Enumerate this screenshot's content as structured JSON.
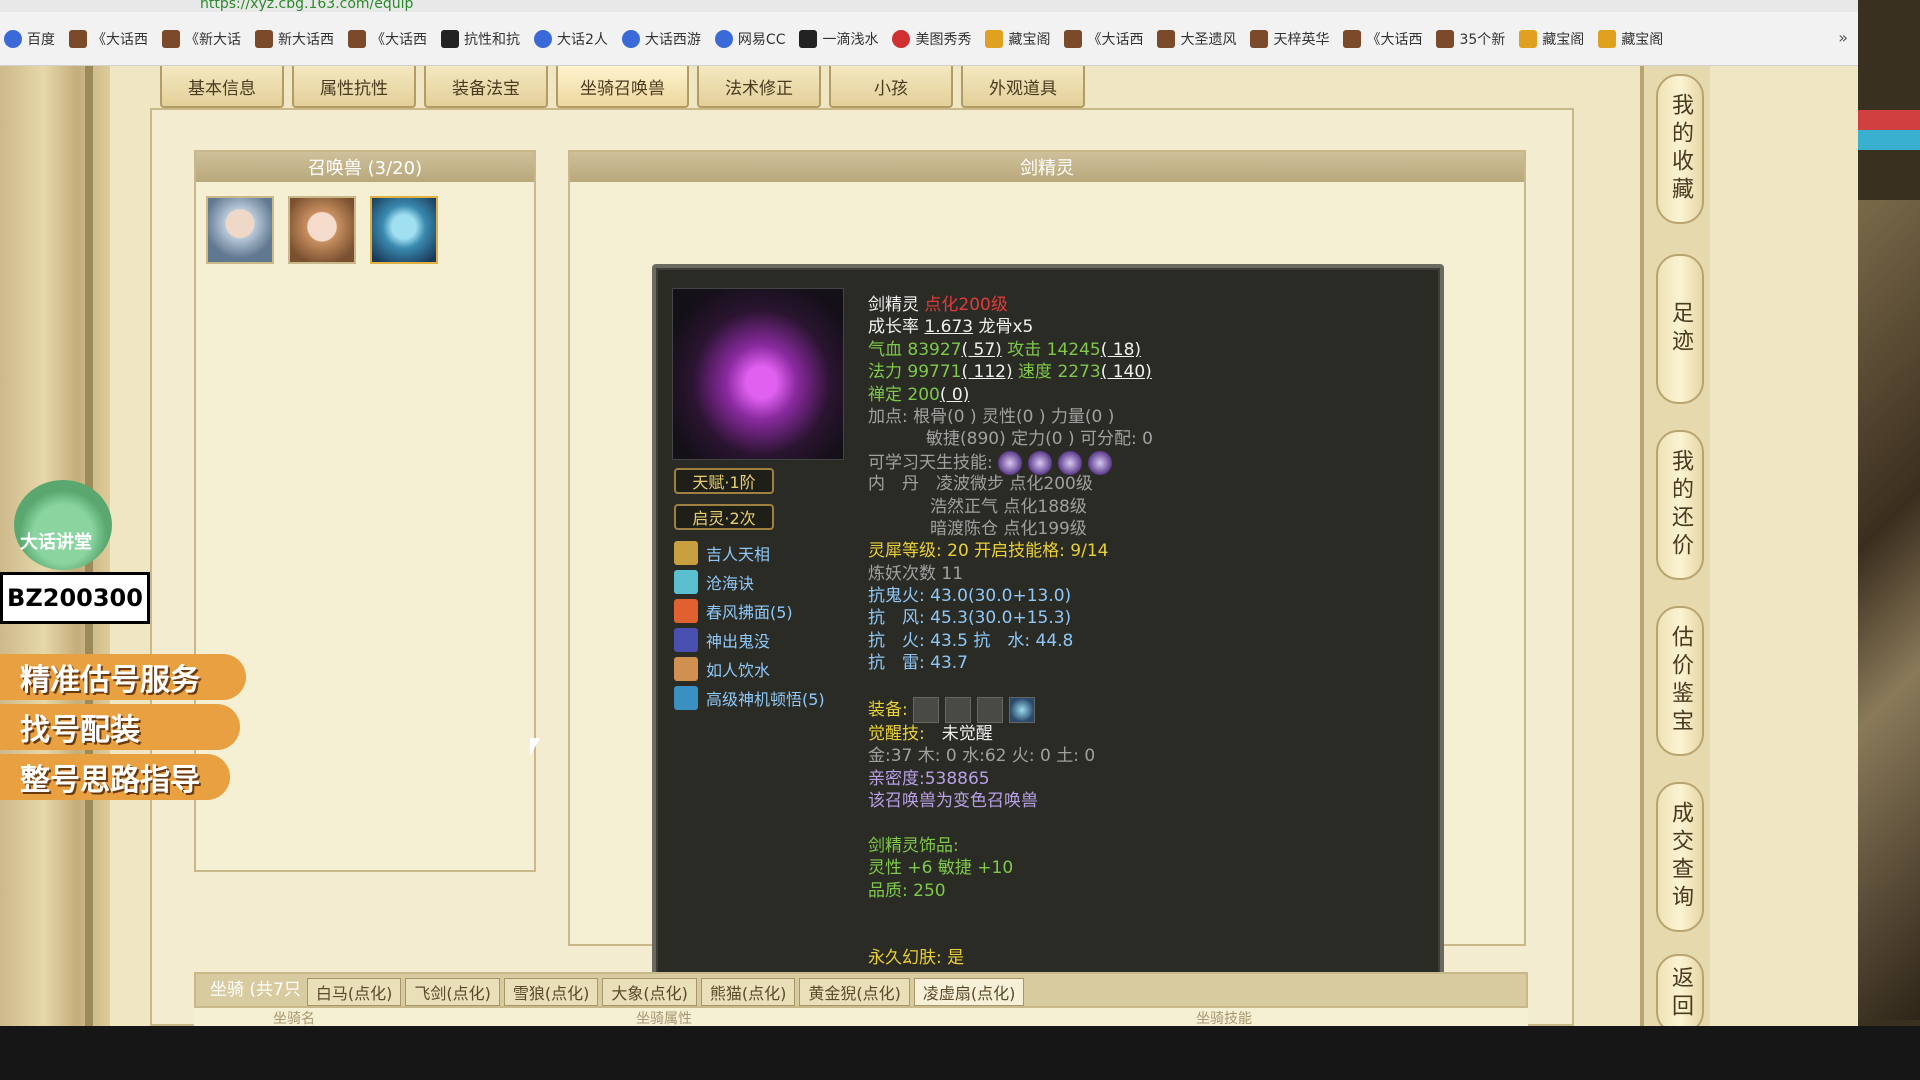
{
  "browser": {
    "url_fragment": "https://xyz.cbg.163.com/equip",
    "bookmarks": [
      "百度",
      "《大话西",
      "《新大话",
      "新大话西",
      "《大话西",
      "抗性和抗",
      "大话2人",
      "大话西游",
      "网易CC",
      "一滴浅水",
      "美图秀秀",
      "藏宝阁",
      "《大话西",
      "大圣遗风",
      "天梓英华",
      "《大话西",
      "35个新",
      "藏宝阁",
      "藏宝阁"
    ],
    "more": "»"
  },
  "tabs": [
    "基本信息",
    "属性抗性",
    "装备法宝",
    "坐骑召唤兽",
    "法术修正",
    "小孩",
    "外观道具"
  ],
  "summons": {
    "title": "召唤兽 (3/20)"
  },
  "detail": {
    "title": "剑精灵",
    "talent_badge": "天赋·1阶",
    "awaken_badge": "启灵·2次",
    "skills": [
      "吉人天相",
      "沧海诀",
      "春风拂面(5)",
      "神出鬼没",
      "如人饮水",
      "高级神机顿悟(5)"
    ],
    "name": "剑精灵",
    "level": "点化200级",
    "growth_label": "成长率",
    "growth_value": "1.673",
    "growth_extra": "龙骨x5",
    "hp_label": "气血",
    "hp": "83927",
    "hp_extra": "( 57)",
    "atk_label": "攻击",
    "atk": "14245",
    "atk_extra": "( 18)",
    "mp_label": "法力",
    "mp": "99771",
    "mp_extra": "( 112)",
    "spd_label": "速度",
    "spd": "2273",
    "spd_extra": "( 140)",
    "ding_label": "禅定",
    "ding": "200",
    "ding_extra": "( 0)",
    "points_label": "加点:",
    "points_line1": "根骨(0 ) 灵性(0 ) 力量(0 )",
    "points_line2": "敏捷(890) 定力(0 ) 可分配: 0",
    "learnable_label": "可学习天生技能:",
    "neidan_label": "内　丹",
    "neidan": [
      "凌波微步 点化200级",
      "浩然正气 点化188级",
      "暗渡陈仓 点化199级"
    ],
    "lingxi": "灵犀等级: 20 开启技能格: 9/14",
    "lianyao": "炼妖次数 11",
    "res": [
      "抗鬼火: 43.0(30.0+13.0)",
      "抗　风: 45.3(30.0+15.3)",
      "抗　火: 43.5 抗　水: 44.8",
      "抗　雷: 43.7"
    ],
    "equip_label": "装备:",
    "awaken_label": "觉醒技:",
    "awaken_value": "未觉醒",
    "elements": "金:37 木: 0 水:62 火: 0 土: 0",
    "intimacy": "亲密度:538865",
    "variant": "该召唤兽为变色召唤兽",
    "ornament_title": "剑精灵饰品:",
    "ornament_attr": "灵性 +6 敏捷 +10",
    "ornament_quality": "品质: 250",
    "skin": "永久幻肤: 是"
  },
  "mounts": {
    "title": "坐骑 (共7只",
    "tabs": [
      "白马(点化)",
      "飞剑(点化)",
      "雪狼(点化)",
      "大象(点化)",
      "熊猫(点化)",
      "黄金猊(点化)",
      "凌虚扇(点化)"
    ],
    "cols": [
      "坐骑名",
      "坐骑属性",
      "坐骑技能"
    ]
  },
  "right_nav": [
    "我的收藏",
    "足迹",
    "我的还价",
    "估价鉴宝",
    "成交查询",
    "返回"
  ],
  "promo": {
    "brand": "大话讲堂",
    "code": "BZ200300",
    "lines": [
      "精准估号服务",
      "找号配装",
      "整号思路指导"
    ]
  },
  "colors": {
    "green": "#7ec84a",
    "yellow": "#e8d038",
    "red": "#e03c3c",
    "blue": "#8fc8f8"
  }
}
